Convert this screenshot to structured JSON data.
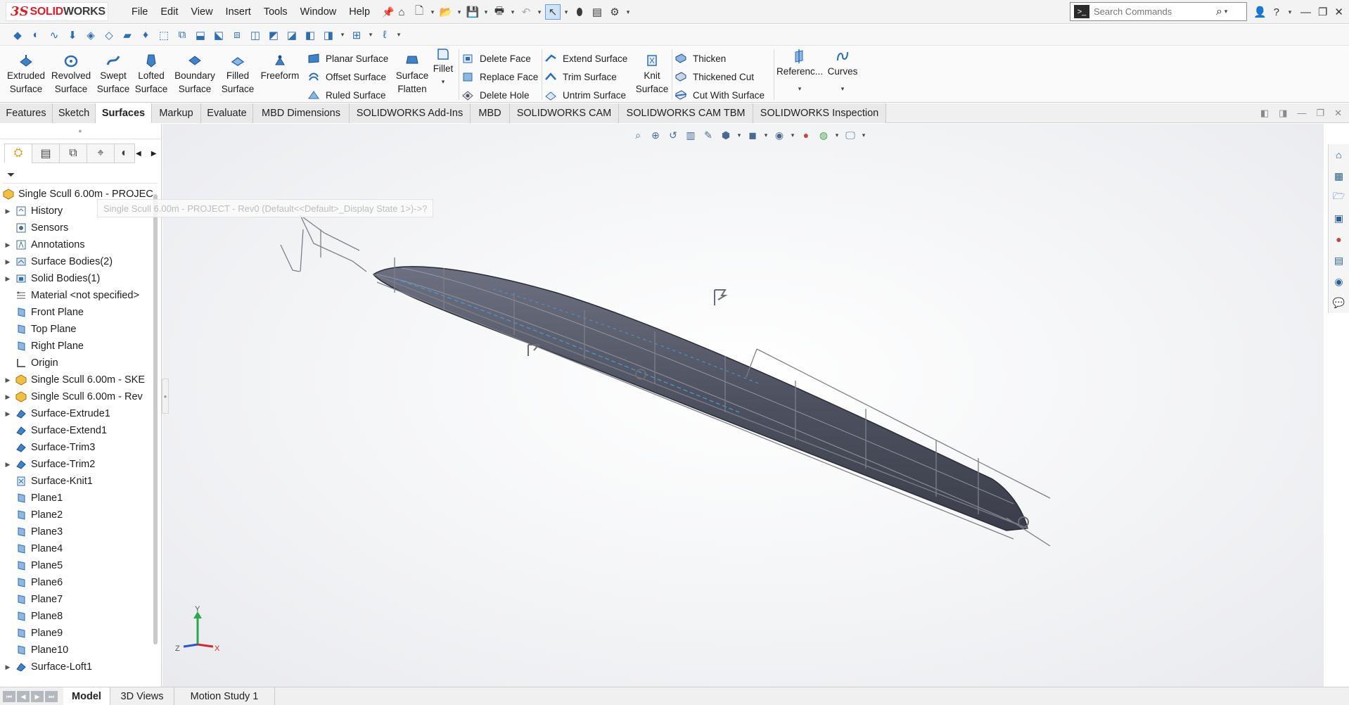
{
  "app": {
    "logo_prefix": "3S",
    "logo_brand_red": "SOLID",
    "logo_brand_dark": "WORKS"
  },
  "menu": [
    "File",
    "Edit",
    "View",
    "Insert",
    "Tools",
    "Window",
    "Help"
  ],
  "search": {
    "placeholder": "Search Commands"
  },
  "ribbon": {
    "big_buttons": [
      {
        "l1": "Extruded",
        "l2": "Surface"
      },
      {
        "l1": "Revolved",
        "l2": "Surface"
      },
      {
        "l1": "Swept",
        "l2": "Surface"
      },
      {
        "l1": "Lofted",
        "l2": "Surface"
      },
      {
        "l1": "Boundary",
        "l2": "Surface"
      },
      {
        "l1": "Filled",
        "l2": "Surface"
      },
      {
        "l1": "Freeform",
        "l2": ""
      }
    ],
    "col1": [
      "Planar Surface",
      "Offset Surface",
      "Ruled Surface"
    ],
    "surface_flatten": {
      "l1": "Surface",
      "l2": "Flatten"
    },
    "fillet": "Fillet",
    "col2": [
      "Delete Face",
      "Replace Face",
      "Delete Hole"
    ],
    "col3": [
      "Extend Surface",
      "Trim Surface",
      "Untrim Surface"
    ],
    "knit": {
      "l1": "Knit",
      "l2": "Surface"
    },
    "col4": [
      "Thicken",
      "Thickened Cut",
      "Cut With Surface"
    ],
    "reference": "Referenc...",
    "curves": "Curves"
  },
  "tabs": [
    "Features",
    "Sketch",
    "Surfaces",
    "Markup",
    "Evaluate",
    "MBD Dimensions",
    "SOLIDWORKS Add-Ins",
    "MBD",
    "SOLIDWORKS CAM",
    "SOLIDWORKS CAM TBM",
    "SOLIDWORKS Inspection"
  ],
  "active_tab": "Surfaces",
  "tree": {
    "root": "Single Scull 6.00m - PROJEC",
    "tooltip": "Single Scull 6.00m - PROJECT - Rev0  (Default<<Default>_Display State 1>)->?",
    "items": [
      {
        "label": "History",
        "icon": "history-icon",
        "exp": true
      },
      {
        "label": "Sensors",
        "icon": "sensors-icon",
        "exp": false
      },
      {
        "label": "Annotations",
        "icon": "annotations-icon",
        "exp": true
      },
      {
        "label": "Surface Bodies(2)",
        "icon": "surface-bodies-icon",
        "exp": true
      },
      {
        "label": "Solid Bodies(1)",
        "icon": "solid-bodies-icon",
        "exp": true
      },
      {
        "label": "Material <not specified>",
        "icon": "material-icon",
        "exp": false
      },
      {
        "label": "Front Plane",
        "icon": "plane-icon",
        "exp": false
      },
      {
        "label": "Top Plane",
        "icon": "plane-icon",
        "exp": false
      },
      {
        "label": "Right Plane",
        "icon": "plane-icon",
        "exp": false
      },
      {
        "label": "Origin",
        "icon": "origin-icon",
        "exp": false
      },
      {
        "label": "Single Scull 6.00m - SKE",
        "icon": "part-icon",
        "exp": true
      },
      {
        "label": "Single Scull 6.00m - Rev",
        "icon": "part-icon",
        "exp": true
      },
      {
        "label": "Surface-Extrude1",
        "icon": "surface-feature-icon",
        "exp": true
      },
      {
        "label": "Surface-Extend1",
        "icon": "surface-feature-icon",
        "exp": false
      },
      {
        "label": "Surface-Trim3",
        "icon": "surface-feature-icon",
        "exp": false
      },
      {
        "label": "Surface-Trim2",
        "icon": "surface-feature-icon",
        "exp": true
      },
      {
        "label": "Surface-Knit1",
        "icon": "knit-icon",
        "exp": false
      },
      {
        "label": "Plane1",
        "icon": "plane-icon",
        "exp": false
      },
      {
        "label": "Plane2",
        "icon": "plane-icon",
        "exp": false
      },
      {
        "label": "Plane3",
        "icon": "plane-icon",
        "exp": false
      },
      {
        "label": "Plane4",
        "icon": "plane-icon",
        "exp": false
      },
      {
        "label": "Plane5",
        "icon": "plane-icon",
        "exp": false
      },
      {
        "label": "Plane6",
        "icon": "plane-icon",
        "exp": false
      },
      {
        "label": "Plane7",
        "icon": "plane-icon",
        "exp": false
      },
      {
        "label": "Plane8",
        "icon": "plane-icon",
        "exp": false
      },
      {
        "label": "Plane9",
        "icon": "plane-icon",
        "exp": false
      },
      {
        "label": "Plane10",
        "icon": "plane-icon",
        "exp": false
      },
      {
        "label": "Surface-Loft1",
        "icon": "surface-feature-icon",
        "exp": true
      }
    ]
  },
  "triad": {
    "x": "X",
    "y": "Y",
    "z": "Z"
  },
  "bottom_tabs": [
    "Model",
    "3D Views",
    "Motion Study 1"
  ],
  "active_bottom_tab": "Model",
  "colors": {
    "accent": "#2d6db3",
    "brand_red": "#d3222a",
    "hull": "#4e5260",
    "triad_x": "#d22a2a",
    "triad_y": "#2aa84a",
    "triad_z": "#2a52d2"
  }
}
